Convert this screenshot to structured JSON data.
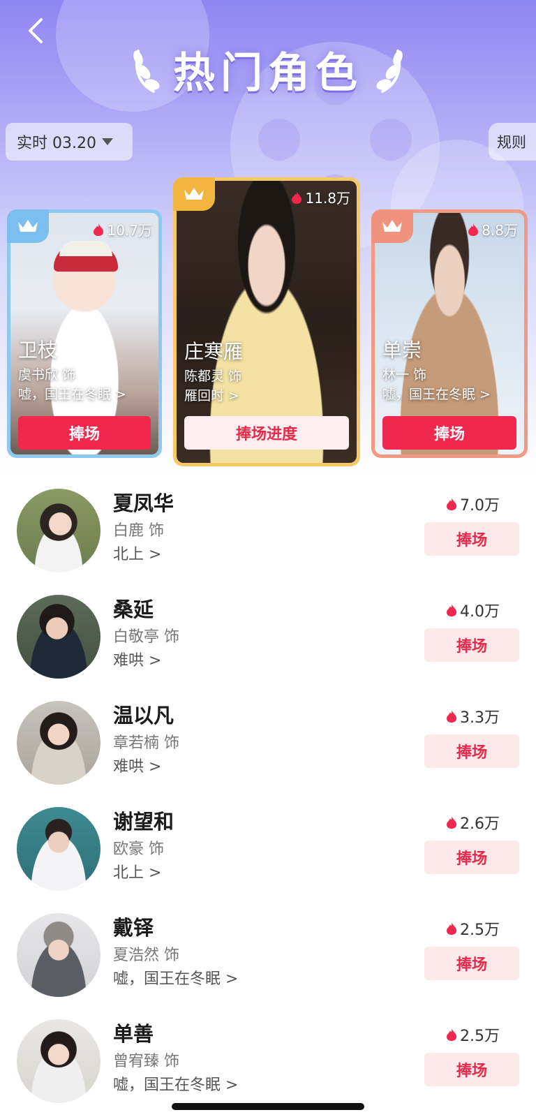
{
  "header": {
    "title": "热门角色",
    "date_filter": "实时 03.20",
    "rules": "规则"
  },
  "top_cards": [
    {
      "rank": 1,
      "role": "庄寒雁",
      "actor": "陈都灵 饰",
      "drama": "雁回时 >",
      "heat": "11.8万",
      "cta": "捧场进度",
      "border_color": "#f5c86a",
      "crown_color": "#f2b640"
    },
    {
      "rank": 2,
      "role": "卫枝",
      "actor": "虞书欣 饰",
      "drama": "嘘，国王在冬眠 >",
      "heat": "10.7万",
      "cta": "捧场",
      "border_color": "#8cc8f0",
      "crown_color": "#7dbef0"
    },
    {
      "rank": 3,
      "role": "单崇",
      "actor": "林一 饰",
      "drama": "嘘，国王在冬眠 >",
      "heat": "8.8万",
      "cta": "捧场",
      "border_color": "#f09a86",
      "crown_color": "#f0937e"
    }
  ],
  "list": [
    {
      "name": "夏凤华",
      "actor": "白鹿 饰",
      "drama": "北上 >",
      "heat": "7.0万",
      "cta": "捧场"
    },
    {
      "name": "桑延",
      "actor": "白敬亭 饰",
      "drama": "难哄 >",
      "heat": "4.0万",
      "cta": "捧场"
    },
    {
      "name": "温以凡",
      "actor": "章若楠 饰",
      "drama": "难哄 >",
      "heat": "3.3万",
      "cta": "捧场"
    },
    {
      "name": "谢望和",
      "actor": "欧豪 饰",
      "drama": "北上 >",
      "heat": "2.6万",
      "cta": "捧场"
    },
    {
      "name": "戴铎",
      "actor": "夏浩然 饰",
      "drama": "嘘，国王在冬眠 >",
      "heat": "2.5万",
      "cta": "捧场"
    },
    {
      "name": "单善",
      "actor": "曾宥臻 饰",
      "drama": "嘘，国王在冬眠 >",
      "heat": "2.5万",
      "cta": "捧场"
    }
  ],
  "colors": {
    "accent_red": "#f0284d",
    "hero_top": "#8f86f2",
    "button_soft": "#fde8ea"
  }
}
